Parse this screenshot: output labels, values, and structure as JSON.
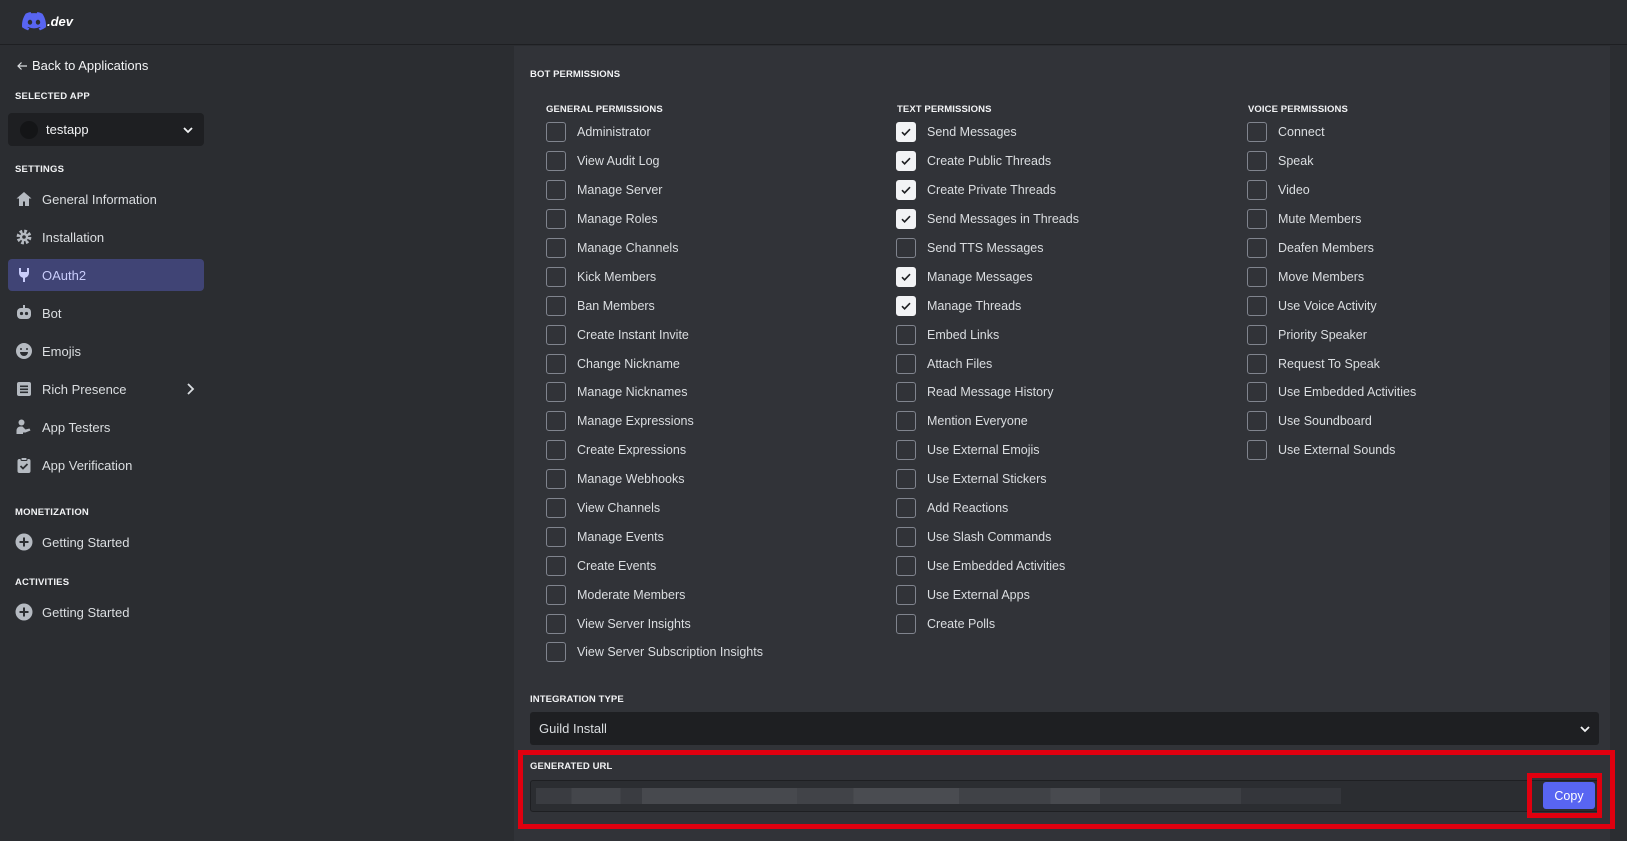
{
  "brand": {
    "logo_text": ".dev"
  },
  "sidebar": {
    "back_link": "Back to Applications",
    "selected_app_label": "SELECTED APP",
    "selected_app_name": "testapp",
    "settings_label": "SETTINGS",
    "settings_items": [
      {
        "label": "General Information",
        "icon": "home-icon"
      },
      {
        "label": "Installation",
        "icon": "gear-icon"
      },
      {
        "label": "OAuth2",
        "icon": "wrench-icon",
        "active": true
      },
      {
        "label": "Bot",
        "icon": "bot-icon"
      },
      {
        "label": "Emojis",
        "icon": "smiley-icon"
      },
      {
        "label": "Rich Presence",
        "icon": "list-icon"
      },
      {
        "label": "App Testers",
        "icon": "user-icon"
      },
      {
        "label": "App Verification",
        "icon": "clipboard-check-icon"
      }
    ],
    "monetization_label": "MONETIZATION",
    "monetization_item": "Getting Started",
    "activities_label": "ACTIVITIES",
    "activities_item": "Getting Started"
  },
  "permissions": {
    "heading": "BOT PERMISSIONS",
    "general": {
      "heading": "GENERAL PERMISSIONS",
      "items": [
        {
          "label": "Administrator",
          "checked": false
        },
        {
          "label": "View Audit Log",
          "checked": false
        },
        {
          "label": "Manage Server",
          "checked": false
        },
        {
          "label": "Manage Roles",
          "checked": false
        },
        {
          "label": "Manage Channels",
          "checked": false
        },
        {
          "label": "Kick Members",
          "checked": false
        },
        {
          "label": "Ban Members",
          "checked": false
        },
        {
          "label": "Create Instant Invite",
          "checked": false
        },
        {
          "label": "Change Nickname",
          "checked": false
        },
        {
          "label": "Manage Nicknames",
          "checked": false
        },
        {
          "label": "Manage Expressions",
          "checked": false
        },
        {
          "label": "Create Expressions",
          "checked": false
        },
        {
          "label": "Manage Webhooks",
          "checked": false
        },
        {
          "label": "View Channels",
          "checked": false
        },
        {
          "label": "Manage Events",
          "checked": false
        },
        {
          "label": "Create Events",
          "checked": false
        },
        {
          "label": "Moderate Members",
          "checked": false
        },
        {
          "label": "View Server Insights",
          "checked": false
        },
        {
          "label": "View Server Subscription Insights",
          "checked": false
        }
      ]
    },
    "text": {
      "heading": "TEXT PERMISSIONS",
      "items": [
        {
          "label": "Send Messages",
          "checked": true
        },
        {
          "label": "Create Public Threads",
          "checked": true
        },
        {
          "label": "Create Private Threads",
          "checked": true
        },
        {
          "label": "Send Messages in Threads",
          "checked": true
        },
        {
          "label": "Send TTS Messages",
          "checked": false
        },
        {
          "label": "Manage Messages",
          "checked": true
        },
        {
          "label": "Manage Threads",
          "checked": true
        },
        {
          "label": "Embed Links",
          "checked": false
        },
        {
          "label": "Attach Files",
          "checked": false
        },
        {
          "label": "Read Message History",
          "checked": false
        },
        {
          "label": "Mention Everyone",
          "checked": false
        },
        {
          "label": "Use External Emojis",
          "checked": false
        },
        {
          "label": "Use External Stickers",
          "checked": false
        },
        {
          "label": "Add Reactions",
          "checked": false
        },
        {
          "label": "Use Slash Commands",
          "checked": false
        },
        {
          "label": "Use Embedded Activities",
          "checked": false
        },
        {
          "label": "Use External Apps",
          "checked": false
        },
        {
          "label": "Create Polls",
          "checked": false
        }
      ]
    },
    "voice": {
      "heading": "VOICE PERMISSIONS",
      "items": [
        {
          "label": "Connect",
          "checked": false
        },
        {
          "label": "Speak",
          "checked": false
        },
        {
          "label": "Video",
          "checked": false
        },
        {
          "label": "Mute Members",
          "checked": false
        },
        {
          "label": "Deafen Members",
          "checked": false
        },
        {
          "label": "Move Members",
          "checked": false
        },
        {
          "label": "Use Voice Activity",
          "checked": false
        },
        {
          "label": "Priority Speaker",
          "checked": false
        },
        {
          "label": "Request To Speak",
          "checked": false
        },
        {
          "label": "Use Embedded Activities",
          "checked": false
        },
        {
          "label": "Use Soundboard",
          "checked": false
        },
        {
          "label": "Use External Sounds",
          "checked": false
        }
      ]
    }
  },
  "integration": {
    "heading": "INTEGRATION TYPE",
    "value": "Guild Install"
  },
  "generated_url": {
    "heading": "GENERATED URL",
    "copy_label": "Copy"
  },
  "colors": {
    "accent": "#5865f2",
    "highlight_frame": "#e0000f",
    "active_nav": "#404475"
  }
}
